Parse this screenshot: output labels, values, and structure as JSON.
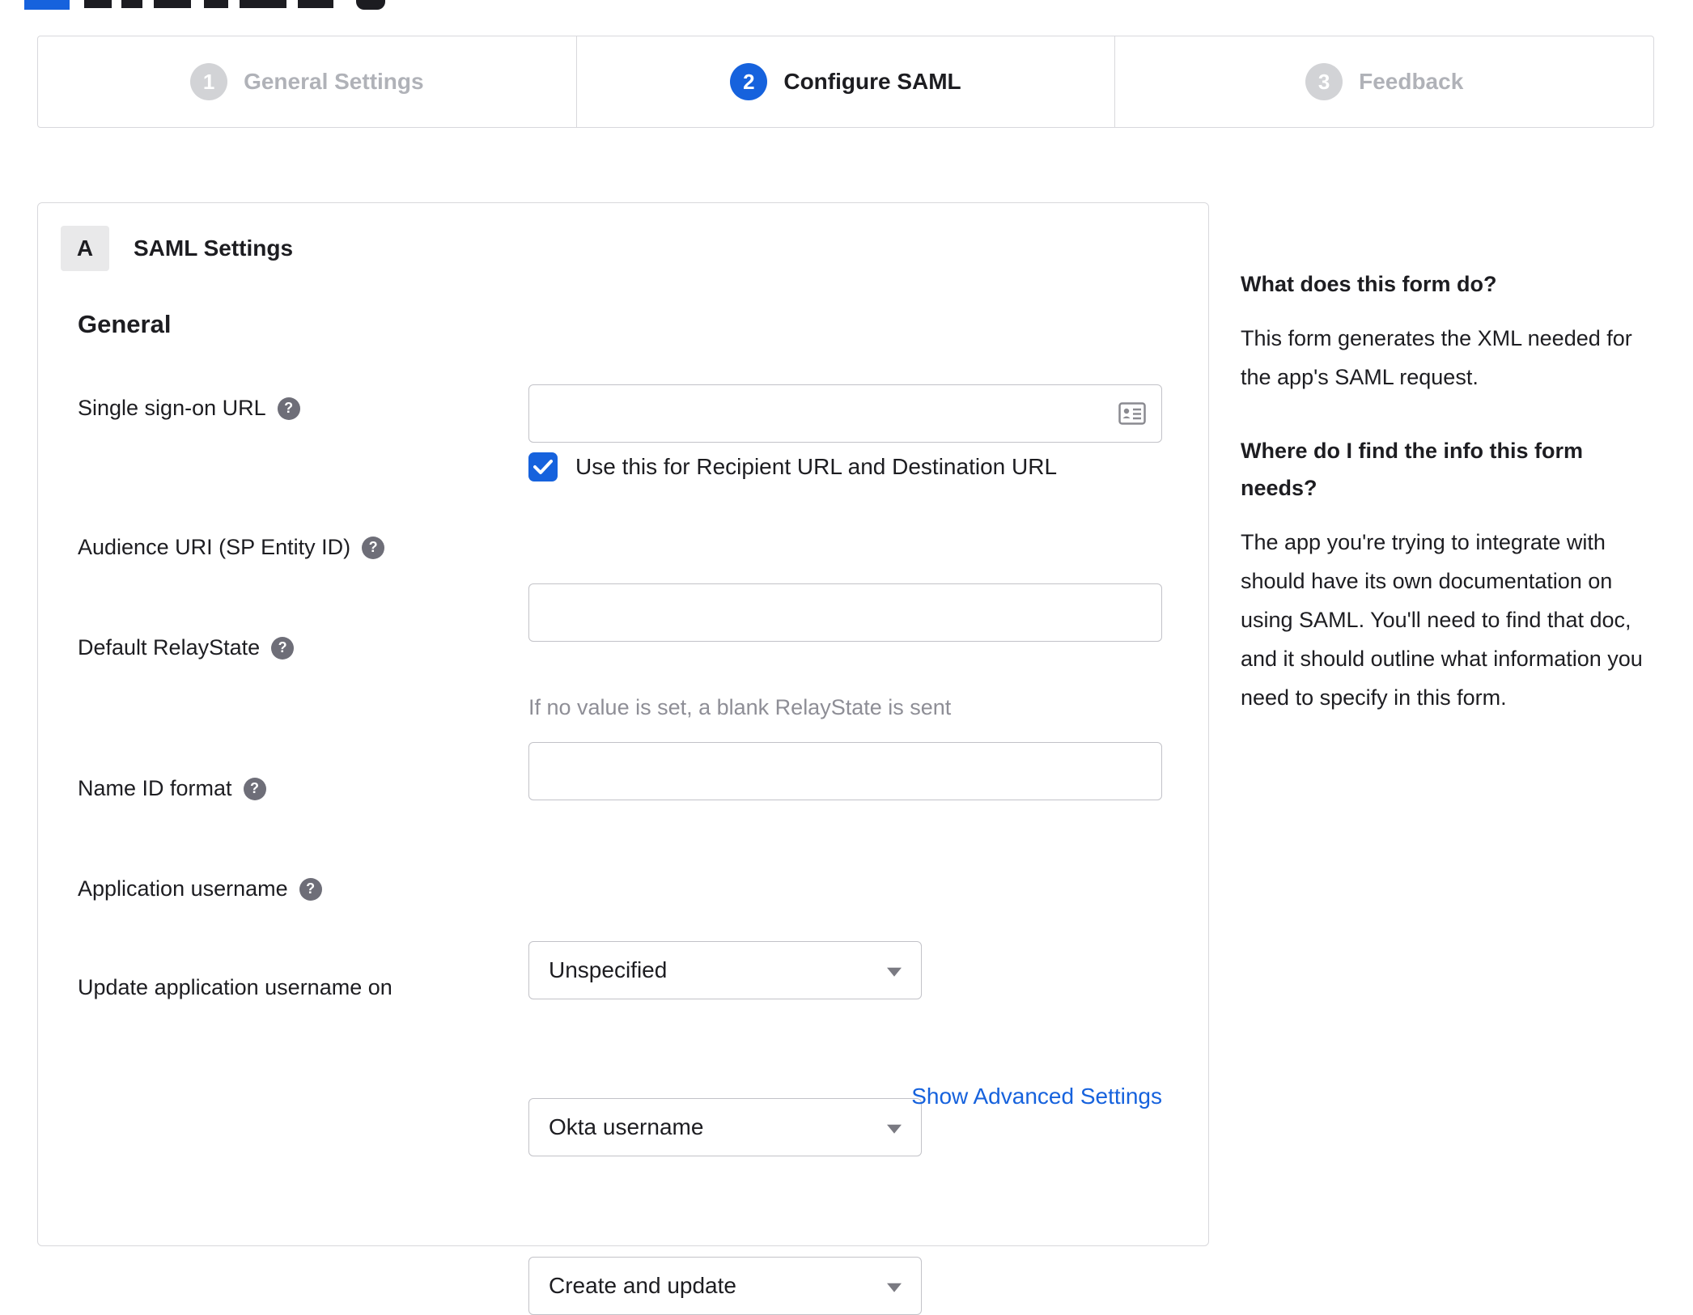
{
  "colors": {
    "accent": "#1662dd",
    "border": "#d8d8dc",
    "inactive_step": "#b0b2b8",
    "hint": "#8e8e96"
  },
  "icons": {
    "help": "?"
  },
  "stepper": {
    "steps": [
      {
        "number": "1",
        "label": "General Settings",
        "state": "inactive"
      },
      {
        "number": "2",
        "label": "Configure SAML",
        "state": "active"
      },
      {
        "number": "3",
        "label": "Feedback",
        "state": "inactive"
      }
    ]
  },
  "panel": {
    "badge": "A",
    "title": "SAML Settings",
    "section": "General",
    "fields": {
      "sso": {
        "label": "Single sign-on URL",
        "value": "",
        "checkbox_label": "Use this for Recipient URL and Destination URL",
        "checked": true
      },
      "audience": {
        "label": "Audience URI (SP Entity ID)",
        "value": ""
      },
      "relay": {
        "label": "Default RelayState",
        "value": "",
        "hint": "If no value is set, a blank RelayState is sent"
      },
      "nameid": {
        "label": "Name ID format",
        "value": "Unspecified"
      },
      "appuser": {
        "label": "Application username",
        "value": "Okta username"
      },
      "update": {
        "label": "Update application username on",
        "value": "Create and update"
      }
    },
    "advanced_link": "Show Advanced Settings"
  },
  "sidebar": {
    "q1": "What does this form do?",
    "a1": "This form generates the XML needed for the app's SAML request.",
    "q2": "Where do I find the info this form needs?",
    "a2": "The app you're trying to integrate with should have its own documentation on using SAML. You'll need to find that doc, and it should outline what information you need to specify in this form."
  }
}
